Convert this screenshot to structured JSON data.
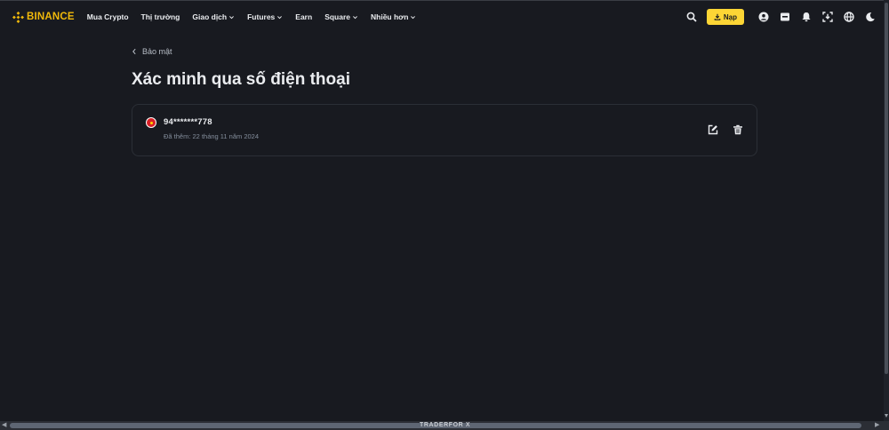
{
  "brand": {
    "name": "BINANCE",
    "color": "#f0b90b"
  },
  "nav": {
    "items": [
      {
        "label": "Mua Crypto",
        "has_dropdown": false
      },
      {
        "label": "Thị trường",
        "has_dropdown": false
      },
      {
        "label": "Giao dịch",
        "has_dropdown": true
      },
      {
        "label": "Futures",
        "has_dropdown": true
      },
      {
        "label": "Earn",
        "has_dropdown": false
      },
      {
        "label": "Square",
        "has_dropdown": true
      },
      {
        "label": "Nhiều hơn",
        "has_dropdown": true
      }
    ]
  },
  "header_actions": {
    "search_icon": "search-icon",
    "deposit_label": "Nạp",
    "deposit_icon": "download-icon",
    "icons": [
      "user-icon",
      "wallet-icon",
      "bell-icon",
      "download-app-icon",
      "globe-icon",
      "moon-icon"
    ]
  },
  "breadcrumb": {
    "back_label": "Bảo mật"
  },
  "page": {
    "title": "Xác minh qua số điện thoại"
  },
  "phone": {
    "country_flag": "vietnam-flag-icon",
    "number": "94*******778",
    "added_label": "Đã thêm: 22 tháng 11 năm 2024",
    "edit_icon": "edit-icon",
    "delete_icon": "trash-icon"
  },
  "watermark": {
    "text": "TRADERFOR X"
  },
  "colors": {
    "background": "#181a20",
    "accent": "#fcd535",
    "text": "#eaecef",
    "muted": "#848e9c",
    "border": "#2b2f36"
  }
}
